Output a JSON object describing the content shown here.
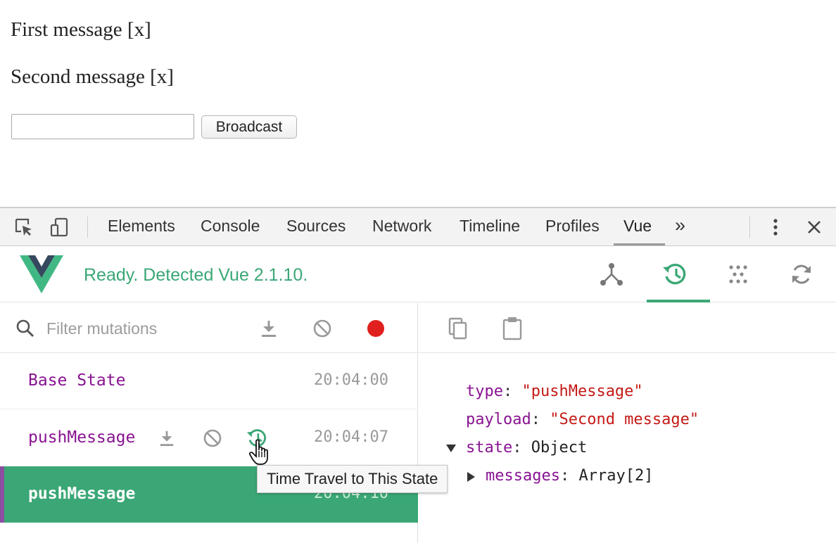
{
  "page": {
    "messages": [
      {
        "text": "First message",
        "remove_label": "[x]"
      },
      {
        "text": "Second message",
        "remove_label": "[x]"
      }
    ],
    "broadcast_input": {
      "value": "",
      "placeholder": ""
    },
    "broadcast_button_label": "Broadcast"
  },
  "devtools": {
    "tabs": [
      {
        "label": "Elements"
      },
      {
        "label": "Console"
      },
      {
        "label": "Sources"
      },
      {
        "label": "Network"
      },
      {
        "label": "Timeline"
      },
      {
        "label": "Profiles"
      },
      {
        "label": "Vue",
        "active": true
      }
    ],
    "more_tabs_label": "»",
    "vue": {
      "status": "Ready. Detected Vue 2.1.10.",
      "active_tab": "vuex-time-travel",
      "filter": {
        "placeholder": "Filter mutations",
        "value": ""
      },
      "mutations": [
        {
          "name": "Base State",
          "time": "20:04:00"
        },
        {
          "name": "pushMessage",
          "time": "20:04:07"
        },
        {
          "name": "pushMessage",
          "time": "20:04:10",
          "selected": true
        }
      ],
      "tooltip": "Time Travel to This State",
      "inspector": {
        "type_key": "type",
        "type_value": "\"pushMessage\"",
        "payload_key": "payload",
        "payload_value": "\"Second message\"",
        "state_key": "state",
        "state_value": "Object",
        "messages_key": "messages",
        "messages_value": "Array[2]"
      }
    },
    "colors": {
      "vue_green": "#3ba776",
      "key_purple": "#881391",
      "string_red": "#c41a16"
    }
  }
}
